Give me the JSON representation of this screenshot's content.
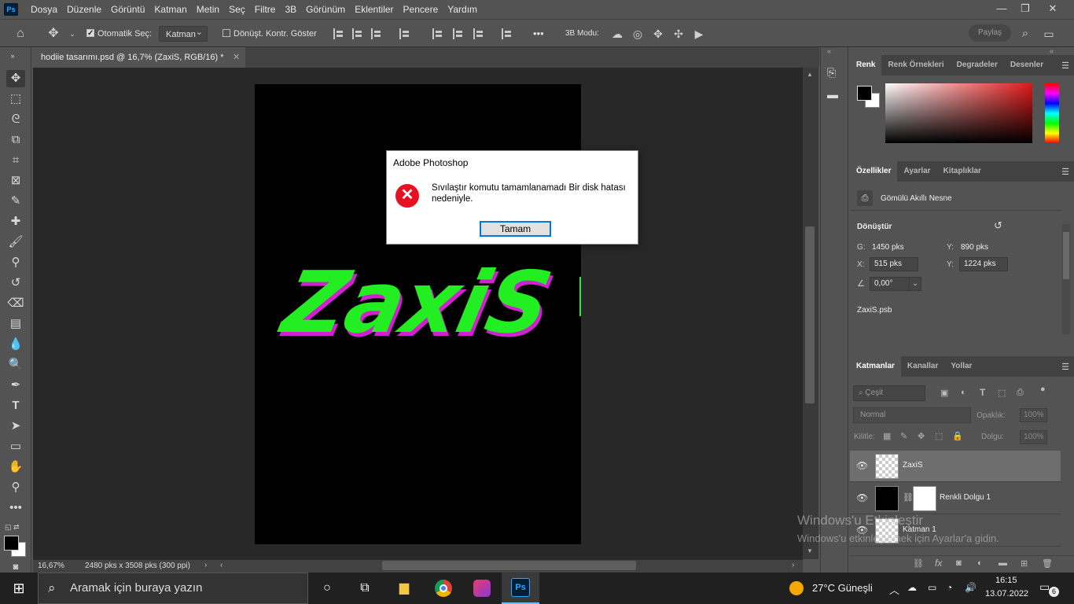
{
  "menu": {
    "logo": "Ps",
    "items": [
      "Dosya",
      "Düzenle",
      "Görüntü",
      "Katman",
      "Metin",
      "Seç",
      "Filtre",
      "3B",
      "Görünüm",
      "Eklentiler",
      "Pencere",
      "Yardım"
    ]
  },
  "options": {
    "auto_select_label": "Otomatik Seç:",
    "auto_select_value": "Katman",
    "transform_controls_label": "Dönüşt. Kontr. Göster",
    "more": "•••",
    "mode_3d_label": "3B Modu:",
    "share_label": "Paylaş"
  },
  "document": {
    "tab_title": "hodiie tasarımı.psd @ 16,7% (ZaxiS, RGB/16) *",
    "zoom": "16,67%",
    "doc_info": "2480 pks x 3508 pks (300 ppi)",
    "artwork_text": "ZaxiS"
  },
  "colors": {
    "app_bg": "#535353",
    "canvas_bg": "#282828",
    "artwork_green": "#22ee22",
    "artwork_magenta": "#d020d0",
    "error_red": "#e81123",
    "focus_blue": "#0078d7"
  },
  "panels": {
    "color_tabs": [
      "Renk",
      "Renk Örnekleri",
      "Degradeler",
      "Desenler"
    ],
    "props_tabs": [
      "Özellikler",
      "Ayarlar",
      "Kitaplıklar"
    ],
    "props": {
      "type": "Gömülü Akıllı Nesne",
      "transform_title": "Dönüştür",
      "w_label": "G:",
      "w_value": "1450 pks",
      "h_label": "Y:",
      "h_value": "890 pks",
      "x_label": "X:",
      "x_value": "515 pks",
      "y_label": "Y:",
      "y_value": "1224 pks",
      "angle_value": "0,00°",
      "file": "ZaxiS.psb"
    },
    "layers_tabs": [
      "Katmanlar",
      "Kanallar",
      "Yollar"
    ],
    "layers": {
      "filter_placeholder": "Çeşit",
      "blend_mode": "Normal",
      "opacity_label": "Opaklık:",
      "opacity_value": "100%",
      "lock_label": "Kilitle:",
      "fill_label": "Dolgu:",
      "fill_value": "100%",
      "items": [
        {
          "name": "ZaxiS",
          "selected": true
        },
        {
          "name": "Renkli Dolgu 1",
          "selected": false
        },
        {
          "name": "Katman 1",
          "selected": false
        }
      ]
    }
  },
  "dialog": {
    "title": "Adobe Photoshop",
    "message": "Sıvılaştır komutu tamamlanamadı Bir disk hatası nedeniyle.",
    "ok_label": "Tamam"
  },
  "watermark": {
    "line1": "Windows'u Etkinleştir",
    "line2": "Windows'u etkinleştirmek için Ayarlar'a gidin."
  },
  "taskbar": {
    "search_placeholder": "Aramak için buraya yazın",
    "weather": "27°C  Güneşli",
    "time": "16:15",
    "date": "13.07.2022",
    "notifications": "6"
  }
}
